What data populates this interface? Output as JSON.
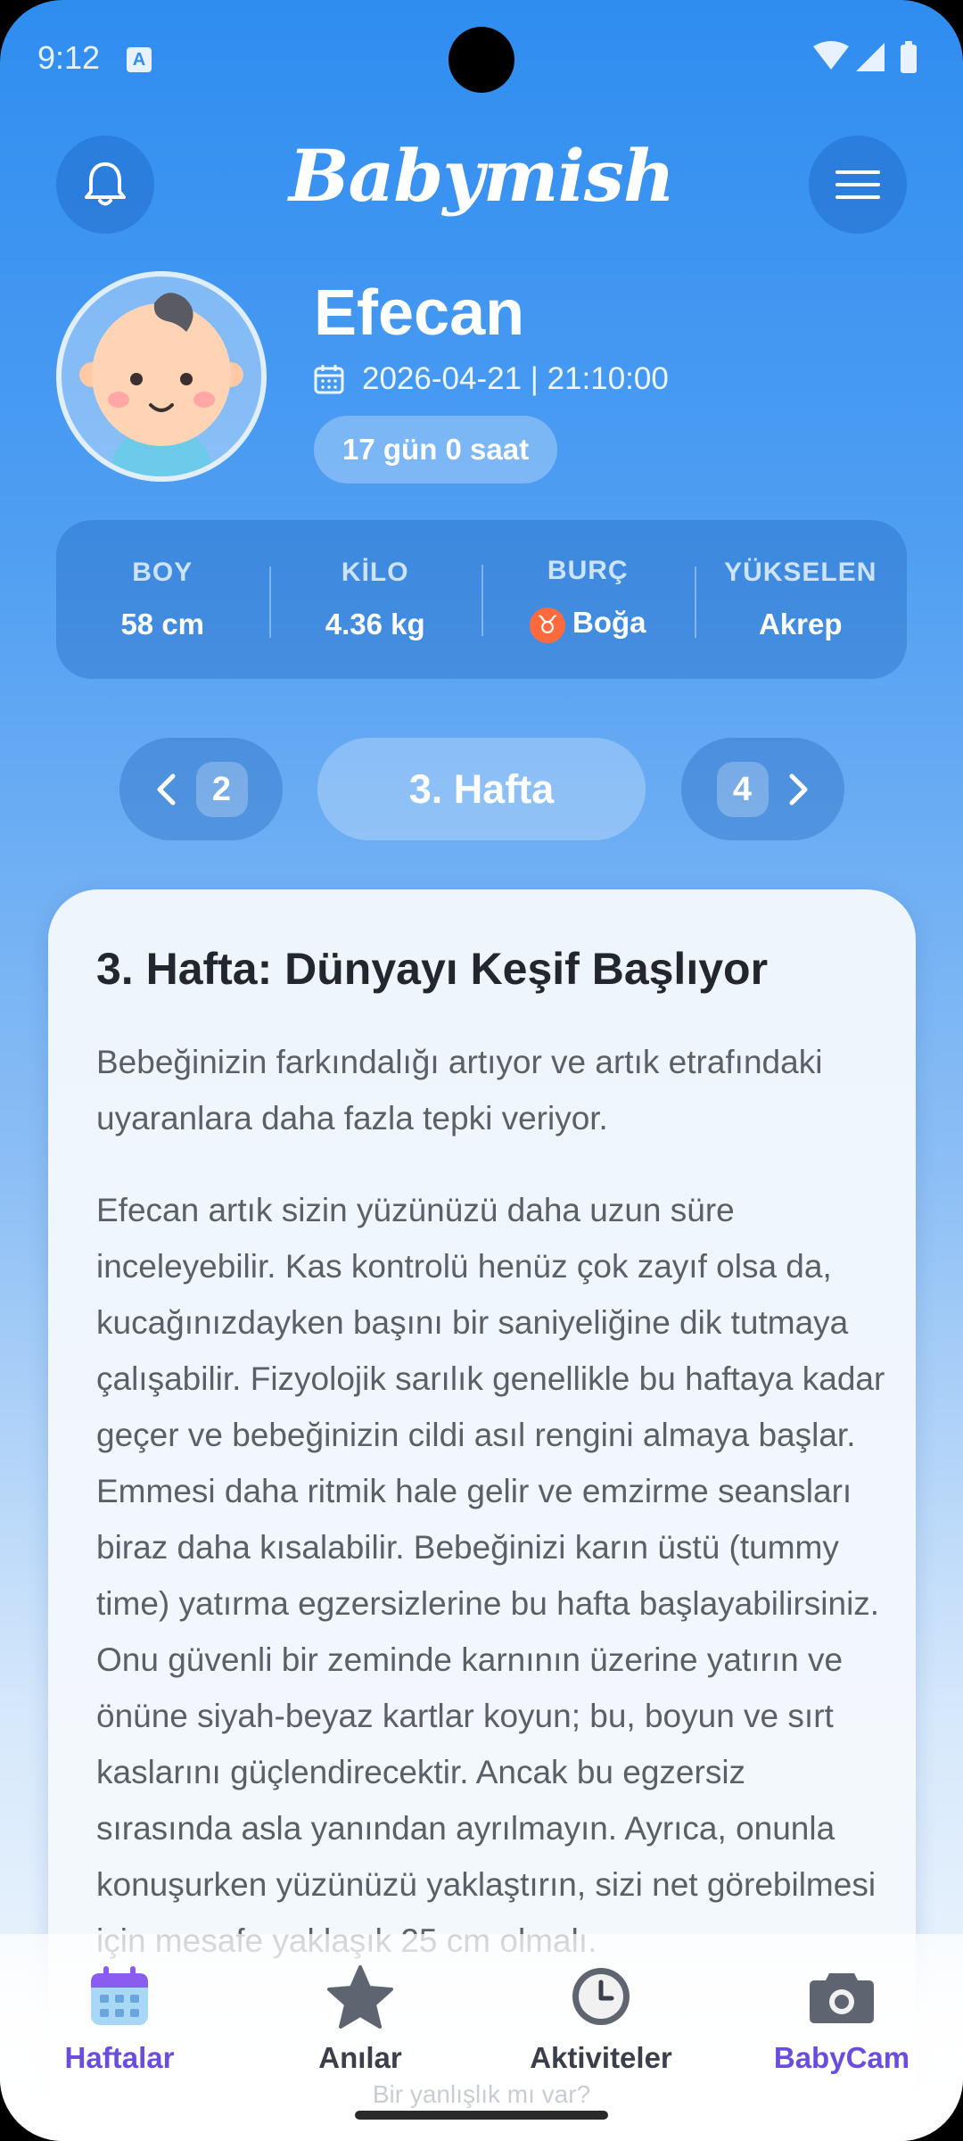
{
  "status_bar": {
    "time": "9:12",
    "notification_icon": "A"
  },
  "header": {
    "logo": "Babymish",
    "bell_icon": "bell-icon",
    "menu_icon": "menu-icon"
  },
  "profile": {
    "name": "Efecan",
    "birth": "2026-04-21 | 21:10:00",
    "age": "17 gün 0 saat"
  },
  "stats": [
    {
      "label": "BOY",
      "value": "58 cm"
    },
    {
      "label": "KİLO",
      "value": "4.36 kg"
    },
    {
      "label": "BURÇ",
      "value": "Boğa",
      "symbol": "♉"
    },
    {
      "label": "YÜKSELEN",
      "value": "Akrep"
    }
  ],
  "week_nav": {
    "prev": "2",
    "current": "3. Hafta",
    "next": "4"
  },
  "card": {
    "title": "3. Hafta: Dünyayı Keşif Başlıyor",
    "intro": "Bebeğinizin farkındalığı artıyor ve artık etrafındaki uyaranlara daha fazla tepki veriyor.",
    "body": "Efecan artık sizin yüzünüzü daha uzun süre inceleyebilir. Kas kontrolü henüz çok zayıf olsa da, kucağınızdayken başını bir saniyeliğine dik tutmaya çalışabilir. Fizyolojik sarılık genellikle bu haftaya kadar geçer ve bebeğinizin cildi asıl rengini almaya başlar. Emmesi daha ritmik hale gelir ve emzirme seansları biraz daha kısalabilir. Bebeğinizi karın üstü (tummy time) yatırma egzersizlerine bu hafta başlayabilirsiniz. Onu güvenli bir zeminde karnının üzerine yatırın ve önüne siyah-beyaz kartlar koyun; bu, boyun ve sırt kaslarını güçlendirecektir. Ancak bu egzersiz sırasında asla yanından ayrılmayın. Ayrıca, onunla konuşurken yüzünüzü yaklaştırın, sizi net görebilmesi için mesafe yaklaşık 25 cm olmalı."
  },
  "bottom_nav": [
    {
      "label": "Haftalar",
      "icon": "calendar-icon",
      "color": "#6a4de0"
    },
    {
      "label": "Anılar",
      "icon": "star-icon",
      "color": "#3a3f4a"
    },
    {
      "label": "Aktiviteler",
      "icon": "clock-icon",
      "color": "#3a3f4a"
    },
    {
      "label": "BabyCam",
      "icon": "camera-icon",
      "color": "#6a4de0"
    }
  ],
  "report_link": "Bir yanlışlık mı var?"
}
